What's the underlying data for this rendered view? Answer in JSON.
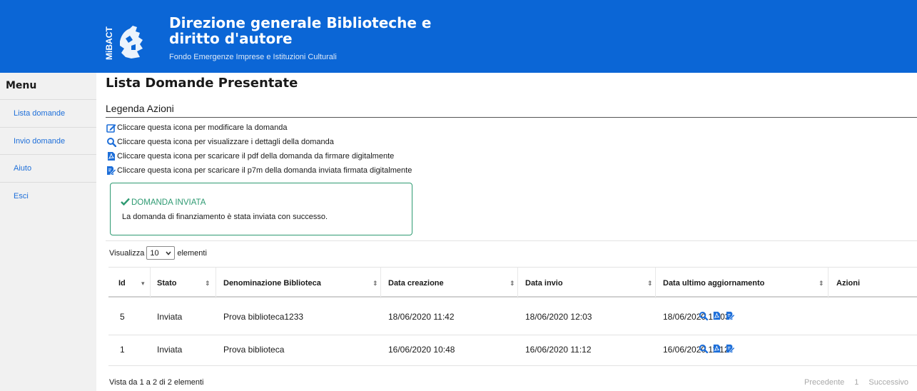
{
  "header": {
    "title": "Direzione generale Biblioteche e diritto d'autore",
    "subtitle": "Fondo Emergenze Imprese e Istituzioni Culturali",
    "logo_text": "MiBACT"
  },
  "sidebar": {
    "title": "Menu",
    "items": [
      {
        "label": "Lista domande"
      },
      {
        "label": "Invio domande"
      },
      {
        "label": "Aiuto"
      },
      {
        "label": "Esci"
      }
    ]
  },
  "main": {
    "page_title": "Lista Domande Presentate",
    "legend_title": "Legenda Azioni",
    "legend": [
      {
        "icon": "edit-icon",
        "text": "Cliccare questa icona per modificare la domanda"
      },
      {
        "icon": "search-icon",
        "text": "Cliccare questa icona per visualizzare i dettagli della domanda"
      },
      {
        "icon": "pdf-icon",
        "text": "Cliccare questa icona per scaricare il pdf della domanda da firmare digitalmente"
      },
      {
        "icon": "signed-doc-icon",
        "text": "Cliccare questa icona per scaricare il p7m della domanda inviata firmata digitalmente"
      }
    ],
    "alert": {
      "title": "DOMANDA INVIATA",
      "message": "La domanda di finanziamento è stata inviata con successo."
    },
    "length_control": {
      "prefix": "Visualizza",
      "value": "10",
      "suffix": "elementi"
    },
    "table": {
      "columns": [
        "Id",
        "Stato",
        "Denominazione Biblioteca",
        "Data creazione",
        "Data invio",
        "Data ultimo aggiornamento",
        "Azioni"
      ],
      "rows": [
        {
          "id": "5",
          "stato": "Inviata",
          "denominazione": "Prova biblioteca1233",
          "data_creazione": "18/06/2020 11:42",
          "data_invio": "18/06/2020 12:03",
          "data_aggiornamento": "18/06/2020 12:03"
        },
        {
          "id": "1",
          "stato": "Inviata",
          "denominazione": "Prova biblioteca",
          "data_creazione": "16/06/2020 10:48",
          "data_invio": "16/06/2020 11:12",
          "data_aggiornamento": "16/06/2020 11:12"
        }
      ]
    },
    "info": "Vista da 1 a 2 di 2 elementi",
    "pagination": {
      "previous": "Precedente",
      "current_page": "1",
      "next": "Successivo"
    }
  },
  "colors": {
    "brand": "#0b66d6",
    "link": "#1e6fd9",
    "success": "#2e9a72"
  }
}
